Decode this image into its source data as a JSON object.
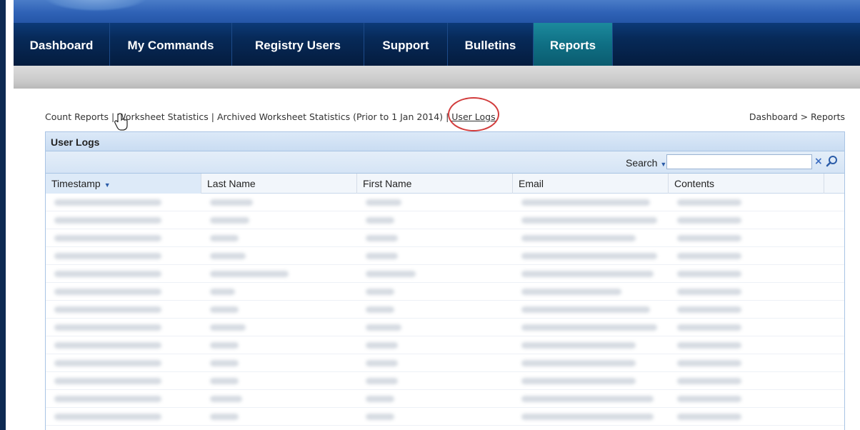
{
  "nav": {
    "tabs": [
      {
        "label": "Dashboard",
        "active": false
      },
      {
        "label": "My Commands",
        "active": false
      },
      {
        "label": "Registry Users",
        "active": false
      },
      {
        "label": "Support",
        "active": false
      },
      {
        "label": "Bulletins",
        "active": false
      },
      {
        "label": "Reports",
        "active": true
      }
    ]
  },
  "report_links": [
    {
      "label": "Count Reports"
    },
    {
      "label": "Worksheet Statistics"
    },
    {
      "label": "Archived Worksheet Statistics (Prior to 1 Jan 2014)"
    },
    {
      "label": "User Logs",
      "current": true
    }
  ],
  "link_separator": "|",
  "breadcrumb": "Dashboard > Reports",
  "panel": {
    "title": "User Logs",
    "search_label": "Search",
    "search_value": ""
  },
  "grid": {
    "columns": [
      "Timestamp",
      "Last Name",
      "First Name",
      "Email",
      "Contents"
    ],
    "sorted_column": "Timestamp",
    "row_count": 13
  },
  "colors": {
    "nav_bg": "#072a59",
    "nav_active": "#0f6f84",
    "panel_header": "#c9dcf2",
    "highlight": "#d23c3c"
  }
}
